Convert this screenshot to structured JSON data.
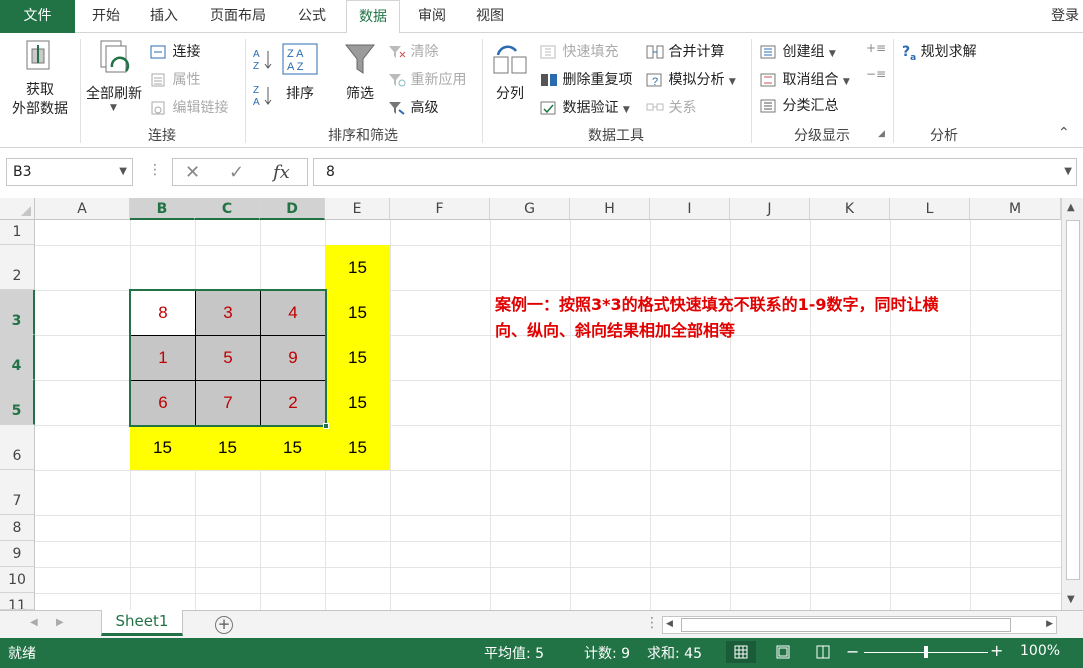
{
  "tabs": [
    "文件",
    "开始",
    "插入",
    "页面布局",
    "公式",
    "数据",
    "审阅",
    "视图"
  ],
  "login": "登录",
  "ribbon": {
    "get_external": [
      "获取",
      "外部数据"
    ],
    "refresh_all": "全部刷新",
    "connections": "连接",
    "properties": "属性",
    "edit_links": "编辑链接",
    "group_connections": "连接",
    "sort": "排序",
    "filter": "筛选",
    "clear": "清除",
    "reapply": "重新应用",
    "advanced": "高级",
    "group_sort_filter": "排序和筛选",
    "text_to_columns": "分列",
    "flash_fill": "快速填充",
    "remove_duplicates": "删除重复项",
    "data_validation": "数据验证",
    "consolidate": "合并计算",
    "what_if": "模拟分析",
    "relationships": "关系",
    "group_data_tools": "数据工具",
    "group_create": "创建组",
    "ungroup": "取消组合",
    "subtotal": "分类汇总",
    "group_outline": "分级显示",
    "solver": "规划求解",
    "group_analysis": "分析"
  },
  "formula_bar": {
    "name_box": "B3",
    "fx": "fx",
    "value": "8"
  },
  "columns": [
    "A",
    "B",
    "C",
    "D",
    "E",
    "F",
    "G",
    "H",
    "I",
    "J",
    "K",
    "L",
    "M"
  ],
  "rows": [
    "1",
    "2",
    "3",
    "4",
    "5",
    "6",
    "7",
    "8",
    "9",
    "10",
    "11"
  ],
  "cells": {
    "E2": "15",
    "B3": "8",
    "C3": "3",
    "D3": "4",
    "E3": "15",
    "B4": "1",
    "C4": "5",
    "D4": "9",
    "E4": "15",
    "B5": "6",
    "C5": "7",
    "D5": "2",
    "E5": "15",
    "B6": "15",
    "C6": "15",
    "D6": "15",
    "E6": "15"
  },
  "note": "案例一：按照3*3的格式快速填充不联系的1-9数字，同时让横向、纵向、斜向结果相加全部相等",
  "sheet_tab": "Sheet1",
  "status": {
    "mode": "就绪",
    "average": "平均值: 5",
    "count": "计数: 9",
    "sum": "求和: 45",
    "zoom": "100%"
  },
  "colors": {
    "accent": "#217346",
    "highlight": "#ffff00",
    "digit": "#c00000",
    "note": "#e00000"
  }
}
